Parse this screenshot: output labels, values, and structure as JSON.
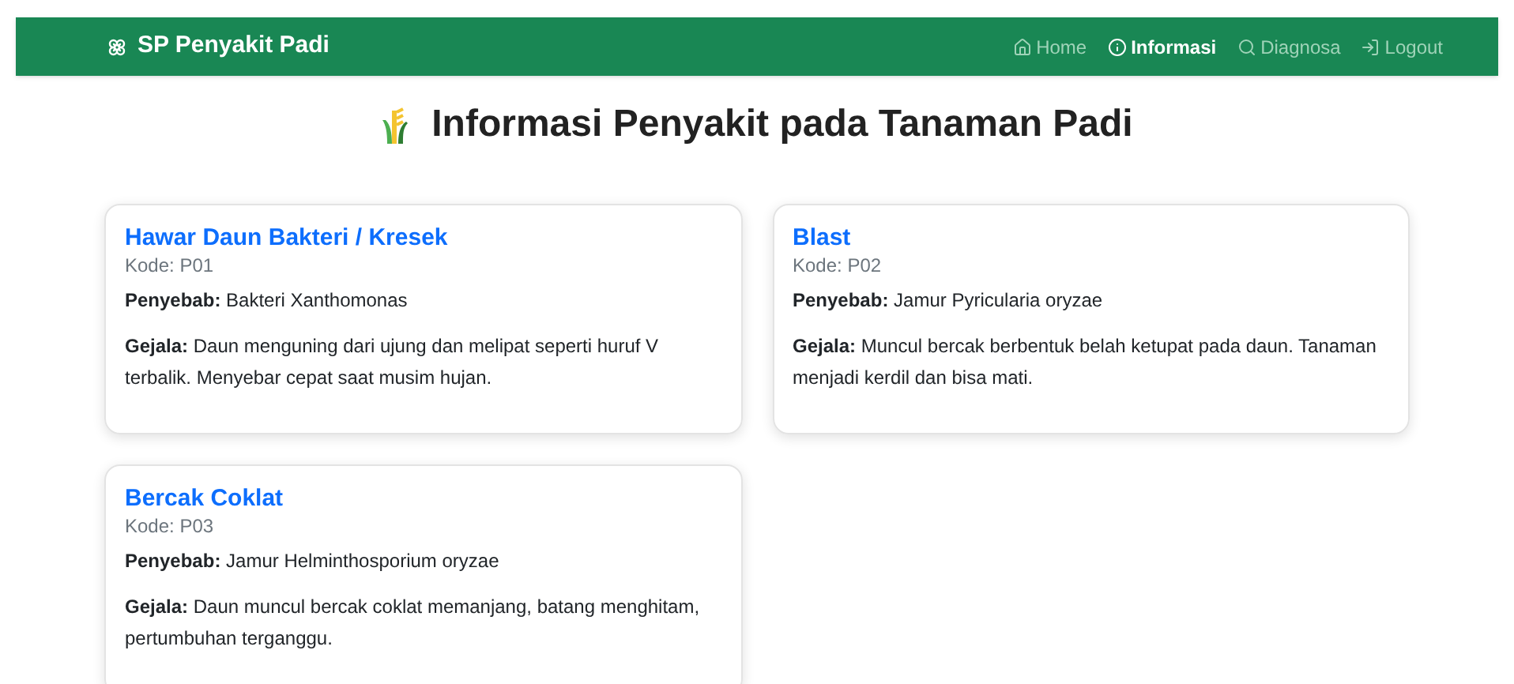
{
  "navbar": {
    "brand": "SP Penyakit Padi",
    "items": [
      {
        "kind": "home",
        "label": "Home",
        "selected": false
      },
      {
        "kind": "info",
        "label": "Informasi",
        "selected": true
      },
      {
        "kind": "search",
        "label": "Diagnosa",
        "selected": false
      },
      {
        "kind": "logout",
        "label": "Logout",
        "selected": false
      }
    ]
  },
  "heading": "Informasi Penyakit pada Tanaman Padi",
  "cards": [
    {
      "name": "Hawar Daun Bakteri / Kresek",
      "code": "Kode: P01",
      "cause_label": "Penyebab:",
      "cause": "Bakteri Xanthomonas",
      "symptom_label": "Gejala:",
      "symptom": "Daun menguning dari ujung dan melipat seperti huruf V terbalik. Menyebar cepat saat musim hujan."
    },
    {
      "name": "Blast",
      "code": "Kode: P02",
      "cause_label": "Penyebab:",
      "cause": "Jamur Pyricularia oryzae",
      "symptom_label": "Gejala:",
      "symptom": "Muncul bercak berbentuk belah ketupat pada daun. Tanaman menjadi kerdil dan bisa mati."
    },
    {
      "name": "Bercak Coklat",
      "code": "Kode: P03",
      "cause_label": "Penyebab:",
      "cause": "Jamur Helminthosporium oryzae",
      "symptom_label": "Gejala:",
      "symptom": "Daun muncul bercak coklat memanjang, batang menghitam, pertumbuhan terganggu."
    }
  ]
}
